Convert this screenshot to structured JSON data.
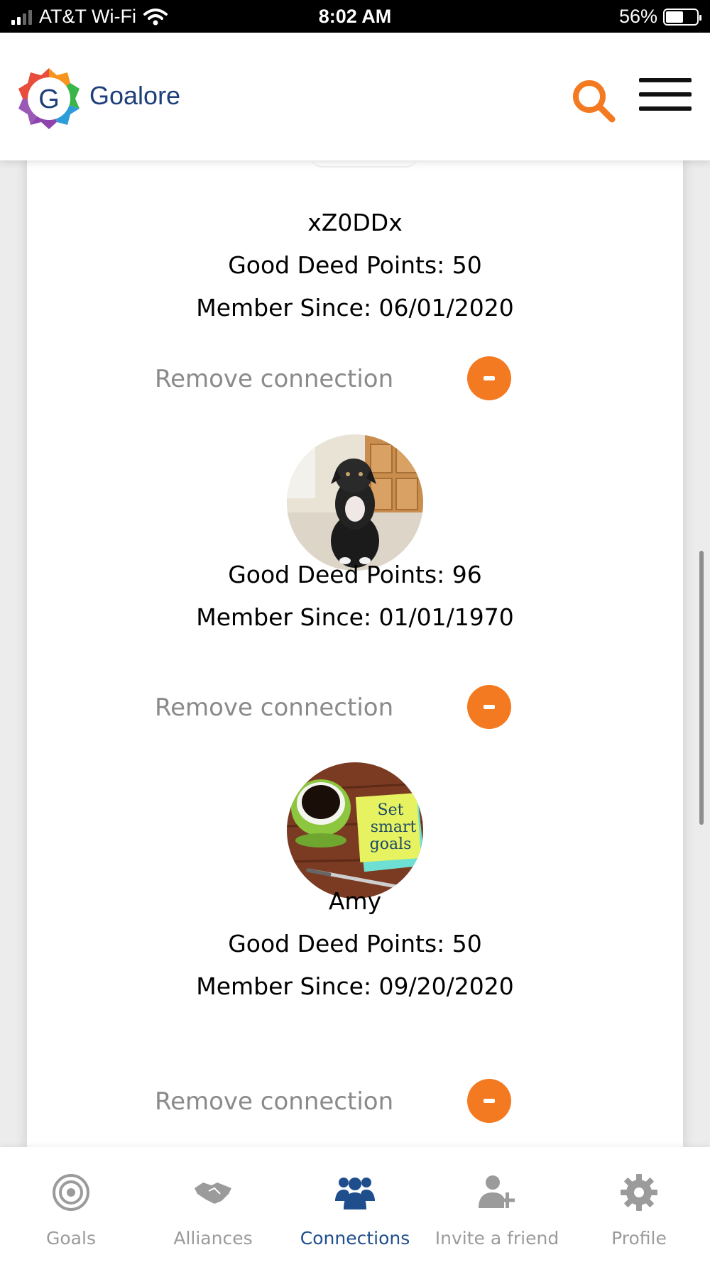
{
  "status_bar": {
    "carrier": "AT&T Wi-Fi",
    "time": "8:02 AM",
    "battery": "56%",
    "battery_level": 0.56
  },
  "header": {
    "brand": "Goalore",
    "logo_letter": "G",
    "icons": [
      "search-icon",
      "hamburger-menu-icon"
    ],
    "accent_color": "#f37a21"
  },
  "connections": [
    {
      "name": "xZ0DDx",
      "points_text": "Good Deed Points: 50",
      "member_since_text": "Member Since: 06/01/2020",
      "remove_label": "Remove connection"
    },
    {
      "name": "",
      "avatar": "dog-photo",
      "points_text": "Good Deed Points: 96",
      "member_since_text": "Member Since: 01/01/1970",
      "remove_label": "Remove connection"
    },
    {
      "name": "Amy",
      "avatar": "coffee-note-photo",
      "avatar_note_text": "Set smart goals",
      "points_text": "Good Deed Points: 50",
      "member_since_text": "Member Since: 09/20/2020",
      "remove_label": "Remove connection"
    }
  ],
  "bottom_nav": {
    "active": "Connections",
    "active_color": "#1f4e8c",
    "items": [
      {
        "label": "Goals",
        "icon": "target-icon"
      },
      {
        "label": "Alliances",
        "icon": "handshake-icon"
      },
      {
        "label": "Connections",
        "icon": "people-group-icon"
      },
      {
        "label": "Invite a friend",
        "icon": "add-user-icon"
      },
      {
        "label": "Profile",
        "icon": "gear-icon"
      }
    ]
  }
}
